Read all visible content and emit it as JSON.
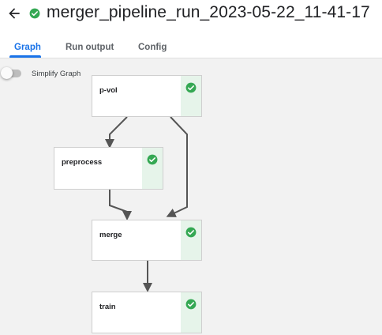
{
  "header": {
    "title": "merger_pipeline_run_2023-05-22_11-41-17",
    "back_icon": "arrow-back-icon",
    "status_icon": "check-circle-icon",
    "status_color": "#34a853"
  },
  "tabs": [
    {
      "label": "Graph",
      "active": true
    },
    {
      "label": "Run output",
      "active": false
    },
    {
      "label": "Config",
      "active": false
    }
  ],
  "graph": {
    "simplify_toggle": {
      "label": "Simplify Graph",
      "on": false
    },
    "nodes": [
      {
        "id": "p-vol",
        "label": "p-vol",
        "status": "succeeded"
      },
      {
        "id": "preprocess",
        "label": "preprocess",
        "status": "succeeded"
      },
      {
        "id": "merge",
        "label": "merge",
        "status": "succeeded"
      },
      {
        "id": "train",
        "label": "train",
        "status": "succeeded"
      }
    ],
    "edges": [
      {
        "from": "p-vol",
        "to": "preprocess"
      },
      {
        "from": "p-vol",
        "to": "merge"
      },
      {
        "from": "preprocess",
        "to": "merge"
      },
      {
        "from": "merge",
        "to": "train"
      }
    ],
    "accent_color": "#1a73e8",
    "success_color": "#34a853",
    "success_bg": "#e6f4ea"
  }
}
